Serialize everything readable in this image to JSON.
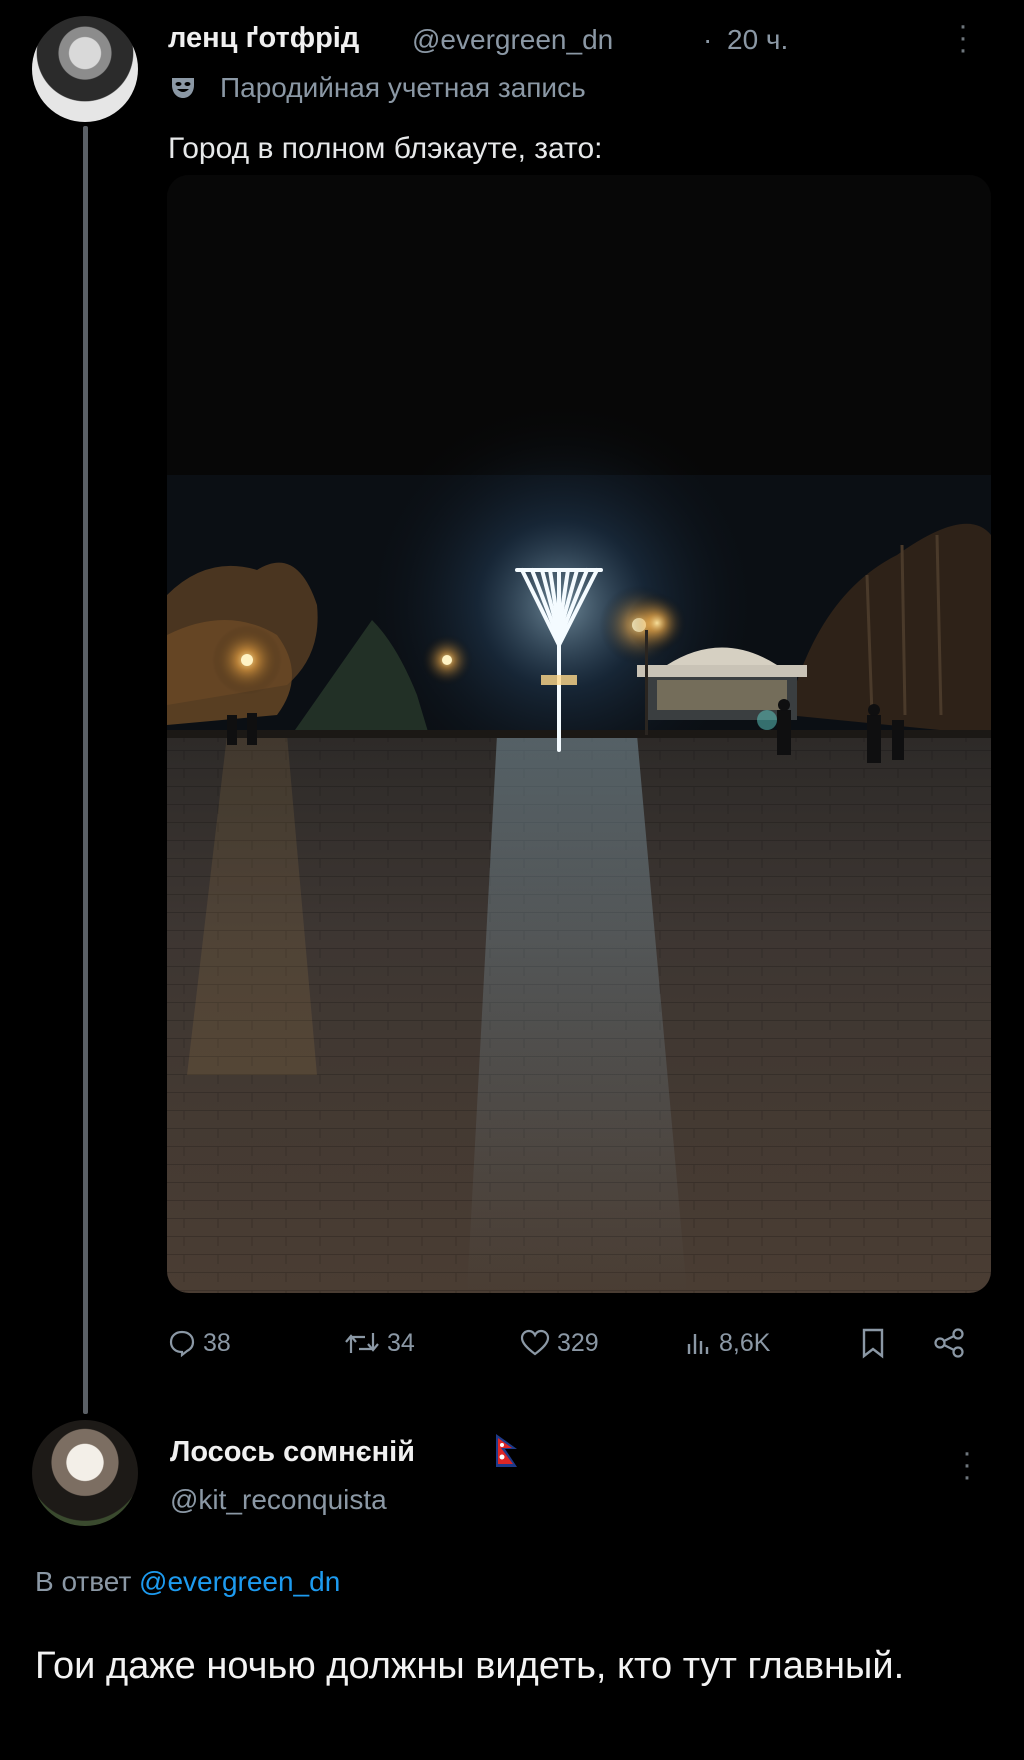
{
  "tweet1": {
    "author_name": "ленц ґотфрід",
    "handle": "@evergreen_dn",
    "separator": "·",
    "time": "20 ч.",
    "parody_label": "Пародийная учетная запись",
    "text": "Город в полном блэкауте, зато:",
    "photo_icon": "menorah-photo",
    "actions": {
      "replies": "38",
      "reposts": "34",
      "likes": "329",
      "views": "8,6K"
    }
  },
  "tweet2": {
    "author_name": "Лосось сомнєній",
    "handle": "@kit_reconquista",
    "reply_prefix": "В ответ",
    "reply_mention": "@evergreen_dn",
    "text": "Гои даже ночью должны видеть, кто тут главный."
  },
  "colors": {
    "background": "#000000",
    "text": "#e7e9ea",
    "secondary": "#8b98a5",
    "link": "#1d9bf0",
    "thread_line": "#5b6066"
  }
}
